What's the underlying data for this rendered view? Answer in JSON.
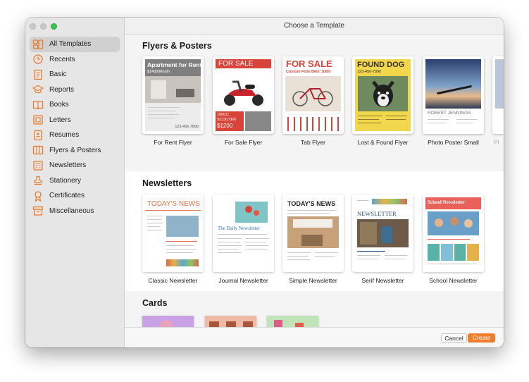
{
  "window": {
    "title": "Choose a Template"
  },
  "sidebar": {
    "items": [
      {
        "label": "All Templates",
        "icon": "grid-icon",
        "selected": true
      },
      {
        "label": "Recents",
        "icon": "clock-icon"
      },
      {
        "label": "Basic",
        "icon": "document-icon"
      },
      {
        "label": "Reports",
        "icon": "graduation-cap-icon"
      },
      {
        "label": "Books",
        "icon": "book-icon"
      },
      {
        "label": "Letters",
        "icon": "letter-icon"
      },
      {
        "label": "Resumes",
        "icon": "person-document-icon"
      },
      {
        "label": "Flyers & Posters",
        "icon": "flyer-icon"
      },
      {
        "label": "Newsletters",
        "icon": "newsletter-icon"
      },
      {
        "label": "Stationery",
        "icon": "stamp-icon"
      },
      {
        "label": "Certificates",
        "icon": "ribbon-icon"
      },
      {
        "label": "Miscellaneous",
        "icon": "archive-icon"
      }
    ]
  },
  "sections": {
    "flyers": {
      "title": "Flyers & Posters",
      "templates": [
        {
          "caption": "For Rent Flyer",
          "title": "Apartment for Rent",
          "price": "$1400/Month",
          "phone": "123.456.7890"
        },
        {
          "caption": "For Sale Flyer",
          "title": "FOR SALE",
          "detail1": "100CC",
          "detail2": "SCOOTER",
          "price": "$1200"
        },
        {
          "caption": "Tab Flyer",
          "title": "FOR SALE",
          "subtitle": "Custom Fixie Bike: $300"
        },
        {
          "caption": "Lost & Found Flyer",
          "title": "FOUND DOG",
          "phone": "123-456-7890"
        },
        {
          "caption": "Photo Poster Small",
          "name": "ROBERT JENNINGS"
        },
        {
          "caption": "Pl"
        }
      ]
    },
    "newsletters": {
      "title": "Newsletters",
      "templates": [
        {
          "caption": "Classic Newsletter",
          "title": "TODAY'S NEWS"
        },
        {
          "caption": "Journal Newsletter",
          "title": "The Daily Newsletter"
        },
        {
          "caption": "Simple Newsletter",
          "title": "TODAY'S NEWS"
        },
        {
          "caption": "Serif Newsletter",
          "title": "NEWSLETTER"
        },
        {
          "caption": "School Newsletter",
          "title": "School Newsletter"
        }
      ]
    },
    "cards": {
      "title": "Cards"
    }
  },
  "footer": {
    "cancel_label": "Cancel",
    "create_label": "Create"
  },
  "colors": {
    "accent": "#f07d2a",
    "sale_red": "#d9443a",
    "dog_yellow": "#f2d64b",
    "school_red": "#e9615a"
  }
}
